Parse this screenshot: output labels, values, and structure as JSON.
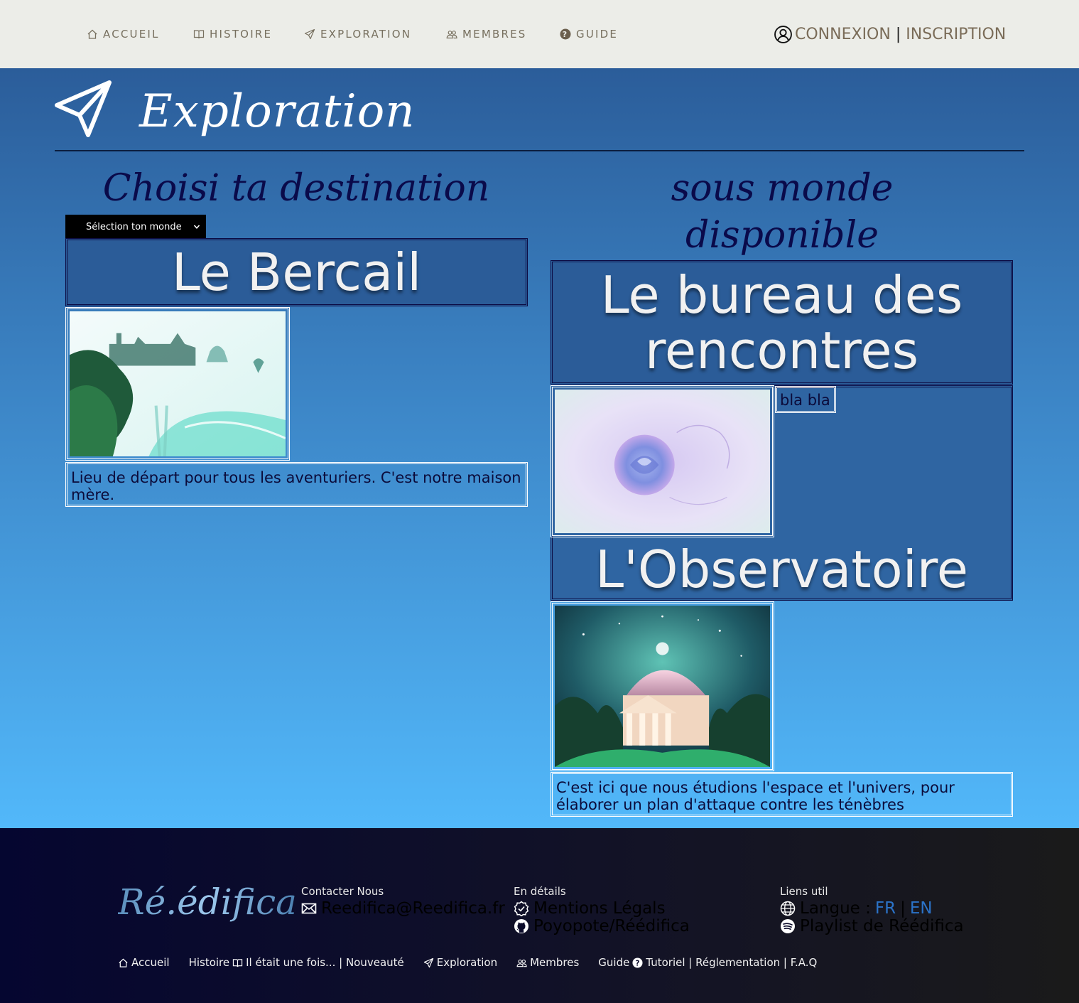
{
  "nav": {
    "items": [
      {
        "label": "ACCUEIL",
        "icon": "home-icon"
      },
      {
        "label": "HISTOIRE",
        "icon": "book-icon"
      },
      {
        "label": "EXPLORATION",
        "icon": "paper-plane-icon"
      },
      {
        "label": "MEMBRES",
        "icon": "users-icon"
      },
      {
        "label": "GUIDE",
        "icon": "question-circle-icon"
      }
    ],
    "login": "CONNEXION",
    "separator": "|",
    "register": "INSCRIPTION"
  },
  "page": {
    "title": "Exploration",
    "left_heading": "Choisi ta destination",
    "right_heading_line1": "sous monde",
    "right_heading_line2": "disponible",
    "select_label": "Sélection ton monde"
  },
  "worlds": {
    "main": {
      "name": "Le Bercail",
      "description": "Lieu de départ pour tous les aventuriers. C'est notre maison mère."
    },
    "sub": [
      {
        "name_line1": "Le bureau des",
        "name_line2": "rencontres",
        "description": "bla bla"
      },
      {
        "name": "L'Observatoire",
        "description": "C'est ici que nous étudions l'espace et l'univers, pour élaborer un plan d'attaque contre les ténèbres"
      }
    ]
  },
  "footer": {
    "logo": "Ré.édifica",
    "contact": {
      "title": "Contacter Nous",
      "email": "Reedifica@Reedifica.fr"
    },
    "details": {
      "title": "En détails",
      "legal": "Mentions Légals",
      "github": "Poyopote/Réédifica"
    },
    "links": {
      "title": "Liens util",
      "lang_label": "Langue :",
      "lang_fr": "FR",
      "lang_sep": "|",
      "lang_en": "EN",
      "playlist": "Playlist de Réédifica"
    },
    "bottom": {
      "accueil": "Accueil",
      "histoire": "Histoire",
      "histoire_sub": "Il était une fois... | Nouveauté",
      "exploration": "Exploration",
      "membres": "Membres",
      "guide": "Guide",
      "guide_sub": "Tutoriel | Réglementation | F.A.Q"
    }
  },
  "colors": {
    "nav_bg": "#ecede8",
    "nav_text": "#77705f",
    "main_gradient_top": "#2b5d9a",
    "main_gradient_bottom": "#52b8fa",
    "heading_dark": "#0a0a4a",
    "card_bg": "#2b5c98",
    "footer_bg": "#050630",
    "lang_link": "#2b73c8"
  }
}
